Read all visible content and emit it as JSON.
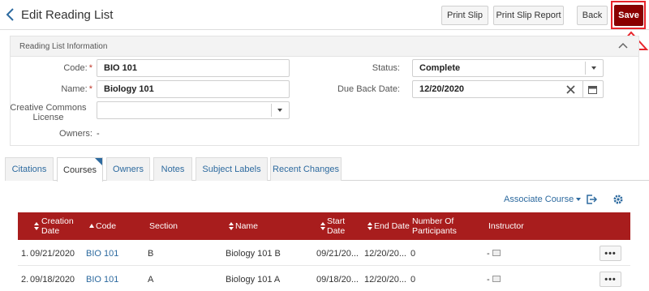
{
  "header": {
    "title": "Edit Reading List",
    "print_slip": "Print Slip",
    "print_slip_report": "Print Slip Report",
    "back": "Back",
    "save": "Save"
  },
  "info": {
    "panel_title": "Reading List Information",
    "code_label": "Code:",
    "code_value": "BIO 101",
    "name_label": "Name:",
    "name_value": "Biology 101",
    "cc_label_line1": "Creative Commons",
    "cc_label_line2": "License",
    "cc_value": "",
    "owners_label": "Owners:",
    "owners_value": "-",
    "status_label": "Status:",
    "status_value": "Complete",
    "due_back_label": "Due Back Date:",
    "due_back_value": "12/20/2020",
    "required_marker": "*"
  },
  "tabs": [
    {
      "label": "Citations"
    },
    {
      "label": "Courses"
    },
    {
      "label": "Owners"
    },
    {
      "label": "Notes"
    },
    {
      "label": "Subject Labels"
    },
    {
      "label": "Recent Changes"
    }
  ],
  "active_tab": "Courses",
  "toolbar": {
    "associate_course": "Associate Course"
  },
  "table": {
    "headers": {
      "creation_date_1": "Creation",
      "creation_date_2": "Date",
      "code": "Code",
      "section": "Section",
      "name": "Name",
      "start_date_1": "Start",
      "start_date_2": "Date",
      "end_date": "End Date",
      "participants_1": "Number Of",
      "participants_2": "Participants",
      "instructor": "Instructor"
    },
    "rows": [
      {
        "num": "1.",
        "creation_date": "09/21/2020",
        "code": "BIO 101",
        "section": "B",
        "name": "Biology 101 B",
        "start_date": "09/21/20...",
        "end_date": "12/20/20...",
        "participants": "0",
        "instructor": "-",
        "actions": "•••"
      },
      {
        "num": "2.",
        "creation_date": "09/18/2020",
        "code": "BIO 101",
        "section": "A",
        "name": "Biology 101 A",
        "start_date": "09/18/20...",
        "end_date": "12/20/20...",
        "participants": "0",
        "instructor": "-",
        "actions": "•••"
      }
    ]
  },
  "colors": {
    "brand_red": "#a81d1d",
    "save_button": "#8b0000",
    "annotation_red": "#e8232a",
    "link_blue": "#2d6a9f"
  },
  "icons": {
    "back": "chevron-left-icon",
    "collapse": "chevron-up-icon",
    "clear": "close-icon",
    "calendar": "calendar-icon",
    "export": "export-icon",
    "settings": "gear-icon",
    "instructor": "user-card-icon",
    "annotation": "up-arrow-icon"
  }
}
